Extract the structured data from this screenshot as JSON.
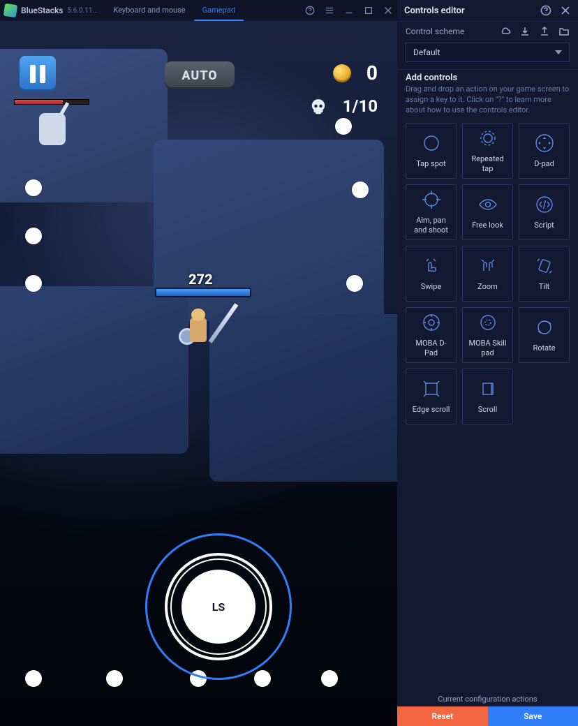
{
  "titlebar": {
    "app_name": "BlueStacks",
    "version": "5.6.0.11...",
    "tabs": {
      "km": "Keyboard and mouse",
      "gp": "Gamepad",
      "active": "gp"
    }
  },
  "hud": {
    "auto_label": "AUTO",
    "coin_count": "0",
    "kill_count": "1/10",
    "hp_value": "272",
    "analog_label": "LS"
  },
  "editor": {
    "title": "Controls editor",
    "scheme_label": "Control scheme",
    "scheme_value": "Default",
    "add_title": "Add controls",
    "add_desc": "Drag and drop an action on your game screen to assign a key to it. Click on \"?\" to learn more about how to use the controls editor.",
    "controls": {
      "tap_spot": "Tap spot",
      "repeated_tap": "Repeated tap",
      "dpad": "D-pad",
      "aim_pan_shoot": "Aim, pan and shoot",
      "free_look": "Free look",
      "script": "Script",
      "swipe": "Swipe",
      "zoom": "Zoom",
      "tilt": "Tilt",
      "moba_dpad": "MOBA D-Pad",
      "moba_skill": "MOBA Skill pad",
      "rotate": "Rotate",
      "edge_scroll": "Edge scroll",
      "scroll": "Scroll"
    },
    "footer": {
      "config_label": "Current configuration actions",
      "reset": "Reset",
      "save": "Save"
    }
  }
}
